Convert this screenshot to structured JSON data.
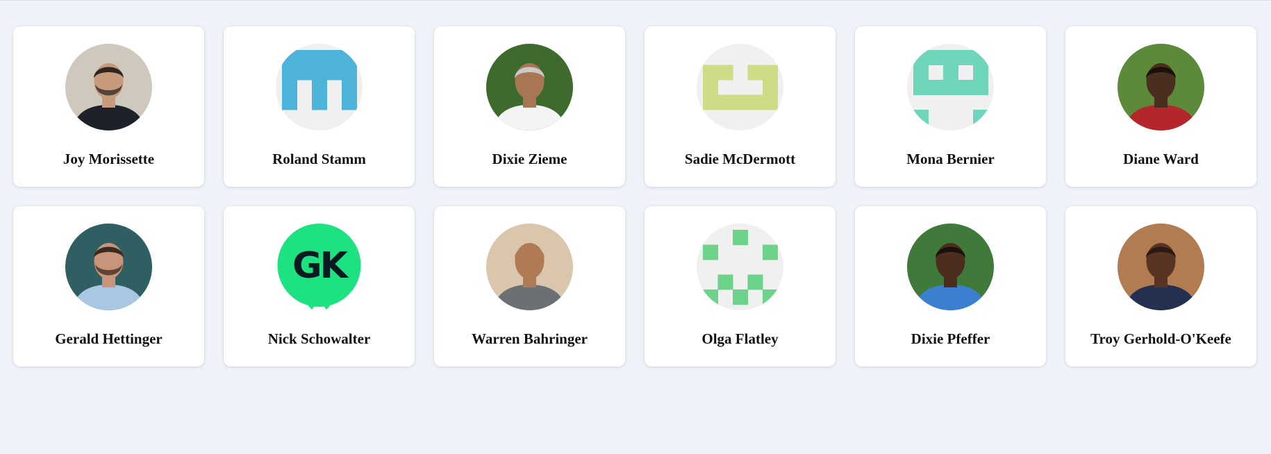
{
  "page": {
    "background": "#eff2f9"
  },
  "users": [
    {
      "name": "Joy Morissette",
      "avatar": "photo",
      "photo": {
        "bg": "#cfc8bd",
        "skin": "#c89a7c",
        "hair": "#2d2622",
        "shirt": "#1d2129",
        "hasBeard": true
      }
    },
    {
      "name": "Roland Stamm",
      "avatar": "identicon",
      "identicon": {
        "color": "#4db3d9",
        "pattern": [
          [
            1,
            1,
            1,
            1,
            1
          ],
          [
            1,
            1,
            1,
            1,
            1
          ],
          [
            1,
            0,
            1,
            0,
            1
          ],
          [
            1,
            0,
            1,
            0,
            1
          ],
          [
            0,
            0,
            0,
            0,
            0
          ]
        ]
      }
    },
    {
      "name": "Dixie Zieme",
      "avatar": "photo",
      "photo": {
        "bg": "#3e6a2e",
        "skin": "#a87652",
        "hair": "#c9c9c9",
        "shirt": "#f4f4f4",
        "hasBeard": false
      }
    },
    {
      "name": "Sadie McDermott",
      "avatar": "identicon",
      "identicon": {
        "color": "#cddd85",
        "pattern": [
          [
            0,
            0,
            0,
            0,
            0
          ],
          [
            1,
            1,
            0,
            1,
            1
          ],
          [
            1,
            0,
            0,
            0,
            1
          ],
          [
            1,
            1,
            1,
            1,
            1
          ],
          [
            0,
            0,
            0,
            0,
            0
          ]
        ]
      }
    },
    {
      "name": "Mona Bernier",
      "avatar": "identicon",
      "identicon": {
        "color": "#6fd6bc",
        "pattern": [
          [
            1,
            1,
            1,
            1,
            1
          ],
          [
            1,
            0,
            1,
            0,
            1
          ],
          [
            1,
            1,
            1,
            1,
            1
          ],
          [
            0,
            0,
            0,
            0,
            0
          ],
          [
            1,
            0,
            0,
            0,
            1
          ]
        ]
      }
    },
    {
      "name": "Diane Ward",
      "avatar": "photo",
      "photo": {
        "bg": "#5c8a3a",
        "skin": "#4a2e1f",
        "hair": "#1a110c",
        "shirt": "#b5262b",
        "hasBeard": false
      }
    },
    {
      "name": "Gerald Hettinger",
      "avatar": "photo",
      "photo": {
        "bg": "#2f5f63",
        "skin": "#c9957a",
        "hair": "#3a2a1f",
        "shirt": "#a9c7e3",
        "hasBeard": true
      }
    },
    {
      "name": "Nick Schowalter",
      "avatar": "initials",
      "initials": {
        "text": "GK",
        "bg": "#1de282",
        "fg": "#0b1a22"
      }
    },
    {
      "name": "Warren Bahringer",
      "avatar": "photo",
      "photo": {
        "bg": "#d9c6ac",
        "skin": "#b07a55",
        "hair": "#b07a55",
        "shirt": "#6c6f73",
        "hasBeard": false
      }
    },
    {
      "name": "Olga Flatley",
      "avatar": "identicon",
      "identicon": {
        "color": "#6bd38a",
        "pattern": [
          [
            0,
            0,
            1,
            0,
            0
          ],
          [
            1,
            0,
            0,
            0,
            1
          ],
          [
            0,
            0,
            0,
            0,
            0
          ],
          [
            0,
            1,
            0,
            1,
            0
          ],
          [
            1,
            0,
            1,
            0,
            1
          ]
        ]
      }
    },
    {
      "name": "Dixie Pfeffer",
      "avatar": "photo",
      "photo": {
        "bg": "#3f7a3a",
        "skin": "#4d2e1e",
        "hair": "#1b110c",
        "shirt": "#3b7fd0",
        "hasBeard": false
      }
    },
    {
      "name": "Troy Gerhold-O'Keefe",
      "avatar": "photo",
      "photo": {
        "bg": "#b27c52",
        "skin": "#5a3422",
        "hair": "#2a1a12",
        "shirt": "#24304f",
        "hasBeard": false
      }
    }
  ]
}
